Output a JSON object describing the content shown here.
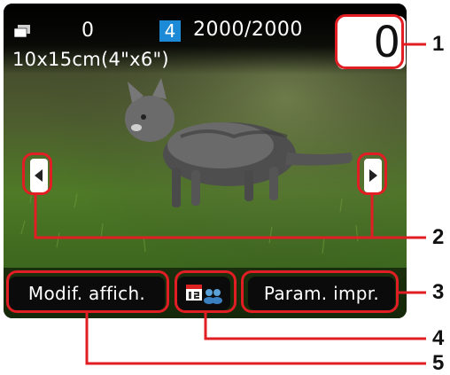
{
  "status": {
    "sheet_count": "0",
    "badge_number": "4",
    "photo_counter": "2000/2000",
    "paper_size": "10x15cm(4\"x6\")"
  },
  "copies": {
    "value": "0"
  },
  "softkeys": {
    "left_label": "Modif. affich.",
    "right_label": "Param. impr."
  },
  "callouts": [
    "1",
    "2",
    "3",
    "4",
    "5"
  ],
  "icons": {
    "stack": "photo-stack-icon",
    "prev": "left-arrow-icon",
    "next": "right-arrow-icon",
    "calendar_people": "date-people-icon"
  },
  "colors": {
    "accent": "#1c8ad6",
    "callout_red": "#e01e24"
  }
}
